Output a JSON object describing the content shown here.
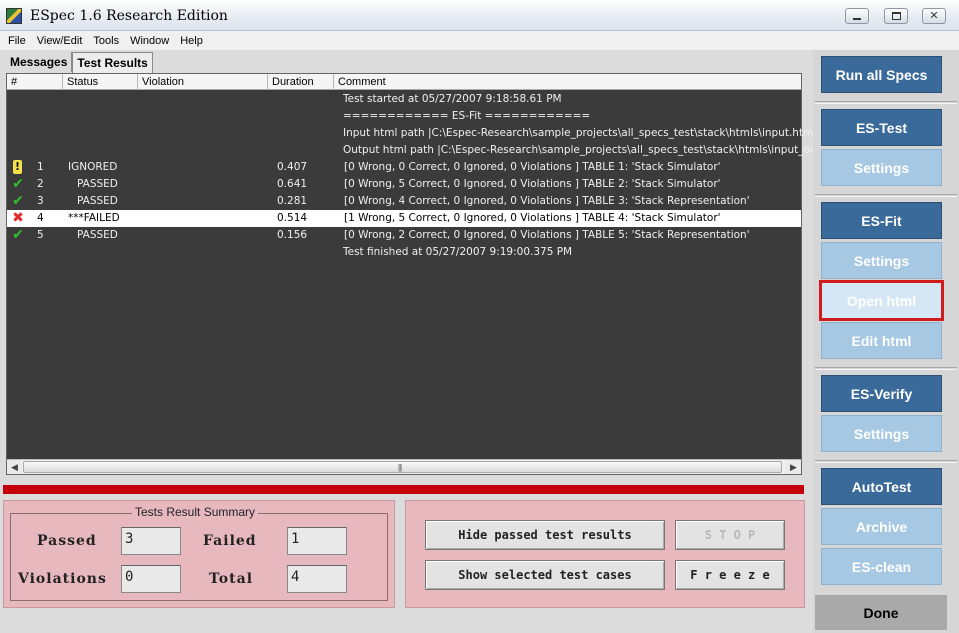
{
  "window": {
    "title": "ESpec 1.6 Research Edition",
    "minimize_glyph": "minimize-icon",
    "maximize_glyph": "maximize-icon",
    "close_glyph": "✕"
  },
  "menu": [
    "File",
    "View/Edit",
    "Tools",
    "Window",
    "Help"
  ],
  "tabs": [
    "Messages",
    "Test Results"
  ],
  "results": {
    "columns": [
      "#",
      "Status",
      "Violation",
      "Duration",
      "Comment"
    ],
    "log_top": [
      "Test started at 05/27/2007 9:18:58.61 PM",
      "============ ES-Fit ============",
      "Input html path |C:\\Espec-Research\\sample_projects\\all_specs_test\\stack\\htmls\\input.htm|",
      "Output html path |C:\\Espec-Research\\sample_projects\\all_specs_test\\stack\\htmls\\input_ou..."
    ],
    "rows": [
      {
        "icon": "!",
        "num": "1",
        "status": "IGNORED",
        "duration": "0.407",
        "comment": "[0 Wrong, 0 Correct, 0 Ignored, 0 Violations ]   TABLE 1: 'Stack Simulator'"
      },
      {
        "icon": "✔",
        "num": "2",
        "status": "PASSED",
        "duration": "0.641",
        "comment": "[0 Wrong, 5 Correct, 0 Ignored, 0 Violations ]   TABLE 2: 'Stack Simulator'"
      },
      {
        "icon": "✔",
        "num": "3",
        "status": "PASSED",
        "duration": "0.281",
        "comment": "[0 Wrong, 4 Correct, 0 Ignored, 0 Violations ]   TABLE 3: 'Stack Representation'"
      },
      {
        "icon": "✖",
        "num": "4",
        "status": "***FAILED",
        "duration": "0.514",
        "comment": "[1 Wrong, 5 Correct, 0 Ignored, 0 Violations ]   TABLE 4: 'Stack Simulator'"
      },
      {
        "icon": "✔",
        "num": "5",
        "status": "PASSED",
        "duration": "0.156",
        "comment": "[0 Wrong, 2 Correct, 0 Ignored, 0 Violations ]   TABLE 5: 'Stack Representation'"
      }
    ],
    "log_bottom": "Test finished at 05/27/2007 9:19:00.375 PM",
    "scroll_grip": "|||",
    "scroll_left": "◀",
    "scroll_right": "▶"
  },
  "summary": {
    "legend": "Tests Result Summary",
    "passed_label": "Passed",
    "passed_value": "3",
    "failed_label": "Failed",
    "failed_value": "1",
    "violations_label": "Violations",
    "violations_value": "0",
    "total_label": "Total",
    "total_value": "4"
  },
  "controls": {
    "hide_passed": "Hide passed test results",
    "stop": "S T O P",
    "show_selected": "Show selected test cases",
    "freeze": "F r e e z e"
  },
  "sidebar": {
    "run_all": "Run all Specs",
    "es_test": "ES-Test",
    "es_test_settings": "Settings",
    "es_fit": "ES-Fit",
    "es_fit_settings": "Settings",
    "open_html": "Open html",
    "edit_html": "Edit html",
    "es_verify": "ES-Verify",
    "es_verify_settings": "Settings",
    "autotest": "AutoTest",
    "archive": "Archive",
    "es_clean": "ES-clean",
    "done": "Done"
  },
  "colors": {
    "failed_bar": "#c4000b",
    "summary_bg": "#e7b8bd",
    "button_dark": "#3a6a9a",
    "button_light": "#a6c8e2",
    "highlight": "#d21b1b"
  }
}
